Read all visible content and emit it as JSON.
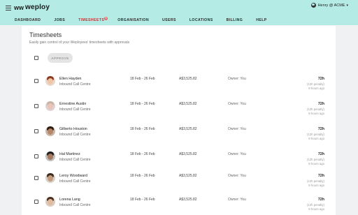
{
  "app": {
    "logo_text": "weploy",
    "logo_mark": "ww",
    "user_label": "Henry @ ACME",
    "badge_count": "9"
  },
  "nav": {
    "items": [
      {
        "label": "DASHBOARD"
      },
      {
        "label": "JOBS"
      },
      {
        "label": "TIMESHEETS"
      },
      {
        "label": "ORGANISATION"
      },
      {
        "label": "USERS"
      },
      {
        "label": "LOCATIONS"
      },
      {
        "label": "BILLING"
      },
      {
        "label": "HELP"
      }
    ],
    "active": "TIMESHEETS"
  },
  "page": {
    "title": "Timesheets",
    "subtitle": "Easily gain control of your Weployees' timesheets with approvals",
    "approve_label": "APPROVE"
  },
  "timesheets": [
    {
      "name": "Ellen Hayden",
      "team": "Inbound Call Centre",
      "period": "18 Feb - 26 Feb",
      "amount": "A$3,525.82",
      "owner": "Owner: You",
      "hours": "72h",
      "penalty": "(12h penalty)",
      "ago": "9 hours ago"
    },
    {
      "name": "Ernestine Austin",
      "team": "Inbound Call Centre",
      "period": "18 Feb - 26 Feb",
      "amount": "A$3,525.82",
      "owner": "Owner: You",
      "hours": "72h",
      "penalty": "(12h penalty)",
      "ago": "9 hours ago"
    },
    {
      "name": "Gilberto Houston",
      "team": "Inbound Call Centre",
      "period": "18 Feb - 26 Feb",
      "amount": "A$3,525.82",
      "owner": "Owner: You",
      "hours": "72h",
      "penalty": "(12h penalty)",
      "ago": "9 hours ago"
    },
    {
      "name": "Hal Martinez",
      "team": "Inbound Call Centre",
      "period": "18 Feb - 26 Feb",
      "amount": "A$3,525.82",
      "owner": "Owner: You",
      "hours": "72h",
      "penalty": "(12h penalty)",
      "ago": "9 hours ago"
    },
    {
      "name": "Leroy Woodward",
      "team": "Inbound Call Centre",
      "period": "18 Feb - 26 Feb",
      "amount": "A$3,525.82",
      "owner": "Owner: You",
      "hours": "72h",
      "penalty": "(12h penalty)",
      "ago": "9 hours ago"
    },
    {
      "name": "Lorena Lang",
      "team": "Inbound Call Centre",
      "period": "18 Feb - 26 Feb",
      "amount": "A$3,525.82",
      "owner": "Owner: You",
      "hours": "72h",
      "penalty": "(12h penalty)",
      "ago": "9 hours ago"
    }
  ],
  "icons": {
    "menu": "hamburger-icon",
    "user": "user-circle-icon",
    "caret": "caret-down-icon"
  },
  "colors": {
    "header_bg": "#b5ebe5",
    "page_bg": "#f0f1f2",
    "active_nav": "#b23a3a",
    "badge": "#e06868"
  }
}
